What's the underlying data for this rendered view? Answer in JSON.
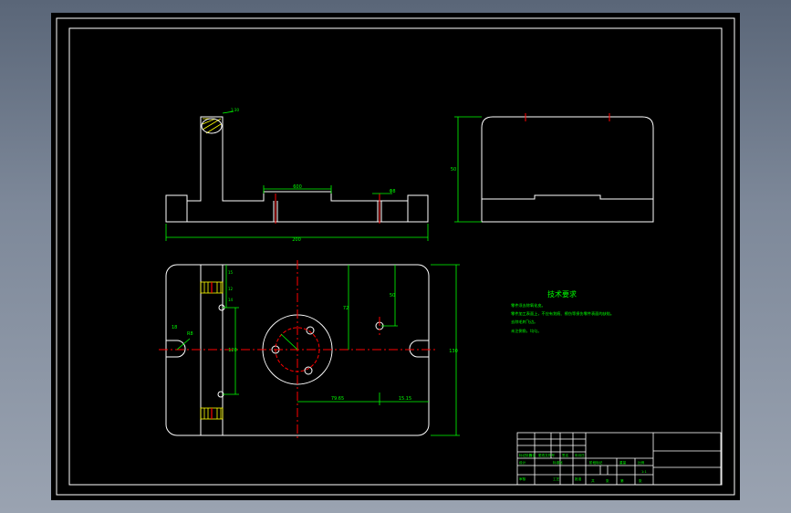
{
  "colors": {
    "background": "#000000",
    "window_bg": "#7f8a9a",
    "outline": "#ffffff",
    "dimension": "#00ff00",
    "centerline": "#ff0000",
    "hatch": "#ffff00"
  },
  "drawing": {
    "title_text": "技术要求",
    "technical_requirements": [
      "零件须去除氧化皮。",
      "零件加工表面上，不应有划痕、擦伤等损伤零件表面的缺陷。",
      "去除毛刺飞边。",
      "未注倒角，均匀。"
    ],
    "front_view_dims": {
      "overall_width": "200",
      "slot_width": "600",
      "bore_dim": "Φ8",
      "top_dim": "1:30"
    },
    "side_view_dims": {
      "height": "50"
    },
    "plan_view_dims": {
      "height": "120",
      "radius_left": "R8",
      "left_a": "18",
      "left_b": "15",
      "left_c": "12",
      "left_d": "14",
      "mid_vertical": "72",
      "center_vertical": "50",
      "bottom_long": "79.65",
      "bottom_short": "15.15",
      "right_height": "130"
    },
    "title_block": {
      "labels": [
        "标记",
        "处数",
        "分区",
        "更改文件号",
        "签名",
        "年月日",
        "设计",
        "标准化",
        "阶段标记",
        "重量",
        "比例",
        "审核",
        "工艺",
        "批准",
        "共",
        "张",
        "第",
        "张"
      ],
      "scale": "1:1"
    }
  }
}
